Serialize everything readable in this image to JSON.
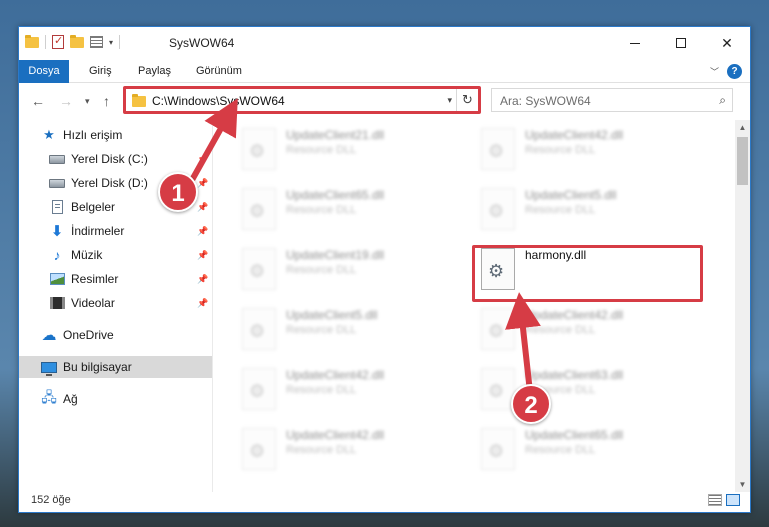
{
  "window": {
    "title": "SysWOW64"
  },
  "ribbon": {
    "tabs": [
      "Dosya",
      "Giriş",
      "Paylaş",
      "Görünüm"
    ]
  },
  "address": {
    "path": "C:\\Windows\\SysWOW64"
  },
  "search": {
    "placeholder": "Ara: SysWOW64"
  },
  "sidebar": {
    "items": [
      {
        "label": "Hızlı erişim",
        "icon": "star-icon"
      },
      {
        "label": "Yerel Disk (C:)",
        "icon": "disk-icon"
      },
      {
        "label": "Yerel Disk (D:)",
        "icon": "disk-icon"
      },
      {
        "label": "Belgeler",
        "icon": "document-icon"
      },
      {
        "label": "İndirmeler",
        "icon": "download-icon"
      },
      {
        "label": "Müzik",
        "icon": "music-icon"
      },
      {
        "label": "Resimler",
        "icon": "pictures-icon"
      },
      {
        "label": "Videolar",
        "icon": "videos-icon"
      },
      {
        "label": "OneDrive",
        "icon": "cloud-icon"
      },
      {
        "label": "Bu bilgisayar",
        "icon": "computer-icon"
      },
      {
        "label": "Ağ",
        "icon": "network-icon"
      }
    ]
  },
  "files": [
    {
      "name": "UpdateClient21.dll",
      "type": "Resource DLL"
    },
    {
      "name": "UpdateClient42.dll",
      "type": "Resource DLL"
    },
    {
      "name": "UpdateClient65.dll",
      "type": "Resource DLL"
    },
    {
      "name": "UpdateClient5.dll",
      "type": "Resource DLL"
    },
    {
      "name": "UpdateClient19.dll",
      "type": "Resource DLL"
    },
    {
      "name": "harmony.dll",
      "type": ""
    },
    {
      "name": "UpdateClient5.dll",
      "type": "Resource DLL"
    },
    {
      "name": "UpdateClient42.dll",
      "type": "Resource DLL"
    },
    {
      "name": "UpdateClient42.dll",
      "type": "Resource DLL"
    },
    {
      "name": "UpdateClient63.dll",
      "type": "Resource DLL"
    },
    {
      "name": "UpdateClient42.dll",
      "type": "Resource DLL"
    },
    {
      "name": "UpdateClient65.dll",
      "type": "Resource DLL"
    }
  ],
  "status": {
    "count": "152 öğe"
  },
  "callouts": {
    "step1": "1",
    "step2": "2"
  },
  "colors": {
    "accent": "#1a6fc0",
    "highlight": "#d63c45"
  }
}
